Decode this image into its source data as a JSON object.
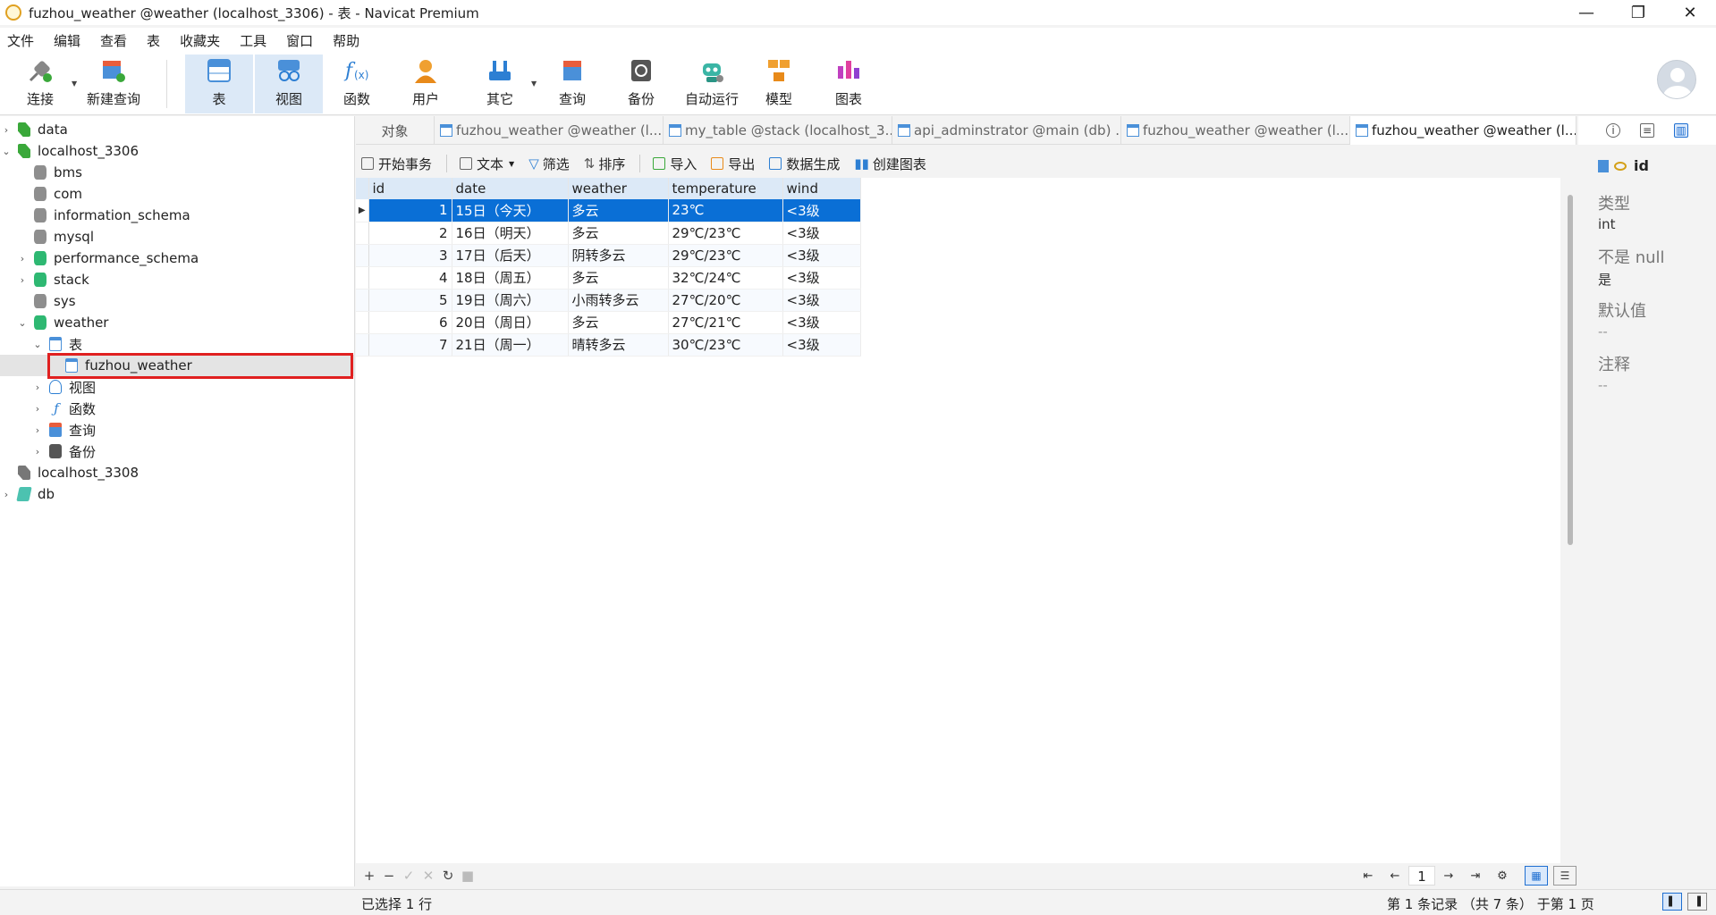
{
  "window": {
    "title": "fuzhou_weather @weather (localhost_3306) - 表 - Navicat Premium",
    "minimize": "—",
    "maximize": "❐",
    "close": "✕"
  },
  "menu": [
    "文件",
    "编辑",
    "查看",
    "表",
    "收藏夹",
    "工具",
    "窗口",
    "帮助"
  ],
  "toolbar": {
    "connect": "连接",
    "new_query": "新建查询",
    "table": "表",
    "view": "视图",
    "function": "函数",
    "user": "用户",
    "other": "其它",
    "query": "查询",
    "backup": "备份",
    "automation": "自动运行",
    "model": "模型",
    "chart": "图表"
  },
  "tree": {
    "data": "data",
    "localhost_3306": "localhost_3306",
    "bms": "bms",
    "com": "com",
    "information_schema": "information_schema",
    "mysql": "mysql",
    "performance_schema": "performance_schema",
    "stack": "stack",
    "sys": "sys",
    "weather": "weather",
    "tables": "表",
    "fuzhou_weather": "fuzhou_weather",
    "views": "视图",
    "functions": "函数",
    "queries": "查询",
    "backups": "备份",
    "localhost_3308": "localhost_3308",
    "db": "db"
  },
  "tabs": {
    "objects": "对象",
    "tab1": "fuzhou_weather @weather (l...",
    "tab2": "my_table @stack (localhost_3...",
    "tab3": "api_adminstrator @main (db) ...",
    "tab4": "fuzhou_weather @weather (l...",
    "tab5": "fuzhou_weather @weather (l..."
  },
  "table_toolbar": {
    "begin_transaction": "开始事务",
    "text": "文本",
    "filter": "筛选",
    "sort": "排序",
    "import": "导入",
    "export": "导出",
    "data_generation": "数据生成",
    "create_chart": "创建图表"
  },
  "grid": {
    "columns": [
      "id",
      "date",
      "weather",
      "temperature",
      "wind"
    ],
    "rows": [
      [
        "1",
        "15日（今天）",
        "多云",
        "23℃",
        "<3级"
      ],
      [
        "2",
        "16日（明天）",
        "多云",
        "29℃/23℃",
        "<3级"
      ],
      [
        "3",
        "17日（后天）",
        "阴转多云",
        "29℃/23℃",
        "<3级"
      ],
      [
        "4",
        "18日（周五）",
        "多云",
        "32℃/24℃",
        "<3级"
      ],
      [
        "5",
        "19日（周六）",
        "小雨转多云",
        "27℃/20℃",
        "<3级"
      ],
      [
        "6",
        "20日（周日）",
        "多云",
        "27℃/21℃",
        "<3级"
      ],
      [
        "7",
        "21日（周一）",
        "晴转多云",
        "30℃/23℃",
        "<3级"
      ]
    ]
  },
  "pager": {
    "page": "1"
  },
  "status": {
    "left": "已选择 1 行",
    "right": "第 1 条记录 （共 7 条） 于第 1 页"
  },
  "info": {
    "field": "id",
    "type_label": "类型",
    "type_value": "int",
    "notnull_label": "不是 null",
    "notnull_value": "是",
    "default_label": "默认值",
    "default_value": "--",
    "comment_label": "注释",
    "comment_value": "--"
  }
}
